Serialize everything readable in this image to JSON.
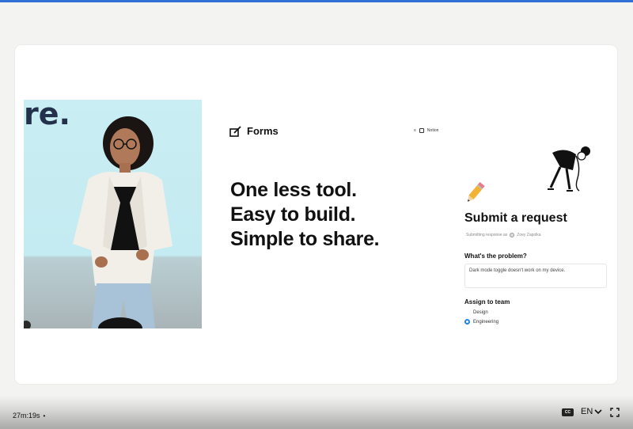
{
  "video": {
    "background_word": "re."
  },
  "slide": {
    "forms_logo_text": "Forms",
    "notion_badge": "Notion",
    "headline": [
      "One less tool.",
      "Easy to build.",
      "Simple to share."
    ],
    "form": {
      "title": "Submit a request",
      "submitting_as_label": "Submitting response as",
      "submitter_name": "Zoey Zapolka",
      "question_label": "What's the problem?",
      "question_answer": "Dark mode toggle doesn't work on my device.",
      "assign_label": "Assign to team",
      "options": [
        {
          "label": "Design",
          "selected": false
        },
        {
          "label": "Engineering",
          "selected": true
        }
      ]
    }
  },
  "controls": {
    "time": "27m:19s",
    "dot": "•",
    "cc_label": "CC",
    "language": "EN"
  },
  "colors": {
    "accent": "#2f6fd6",
    "radio_selected": "#2383e2"
  },
  "icons": [
    "forms-icon",
    "notion-icon",
    "pencil-icon",
    "chevron-down-icon",
    "fullscreen-icon"
  ]
}
